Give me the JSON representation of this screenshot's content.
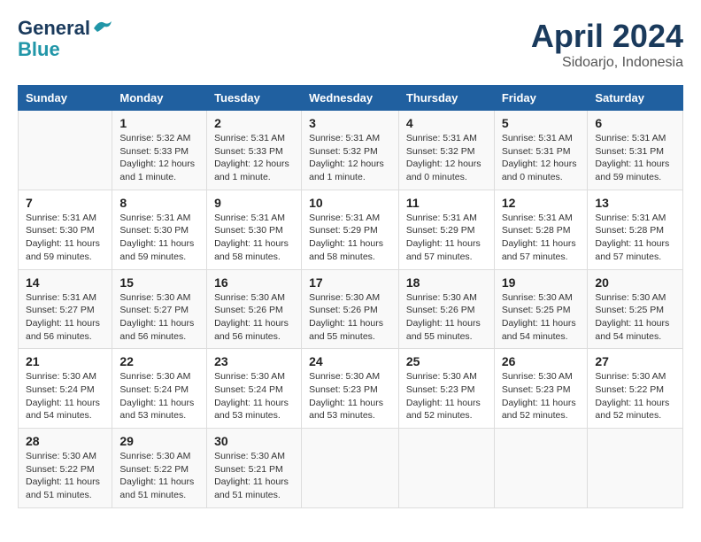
{
  "logo": {
    "line1": "General",
    "line2": "Blue"
  },
  "title": "April 2024",
  "location": "Sidoarjo, Indonesia",
  "days_header": [
    "Sunday",
    "Monday",
    "Tuesday",
    "Wednesday",
    "Thursday",
    "Friday",
    "Saturday"
  ],
  "weeks": [
    [
      {
        "num": "",
        "info": ""
      },
      {
        "num": "1",
        "info": "Sunrise: 5:32 AM\nSunset: 5:33 PM\nDaylight: 12 hours\nand 1 minute."
      },
      {
        "num": "2",
        "info": "Sunrise: 5:31 AM\nSunset: 5:33 PM\nDaylight: 12 hours\nand 1 minute."
      },
      {
        "num": "3",
        "info": "Sunrise: 5:31 AM\nSunset: 5:32 PM\nDaylight: 12 hours\nand 1 minute."
      },
      {
        "num": "4",
        "info": "Sunrise: 5:31 AM\nSunset: 5:32 PM\nDaylight: 12 hours\nand 0 minutes."
      },
      {
        "num": "5",
        "info": "Sunrise: 5:31 AM\nSunset: 5:31 PM\nDaylight: 12 hours\nand 0 minutes."
      },
      {
        "num": "6",
        "info": "Sunrise: 5:31 AM\nSunset: 5:31 PM\nDaylight: 11 hours\nand 59 minutes."
      }
    ],
    [
      {
        "num": "7",
        "info": "Sunrise: 5:31 AM\nSunset: 5:30 PM\nDaylight: 11 hours\nand 59 minutes."
      },
      {
        "num": "8",
        "info": "Sunrise: 5:31 AM\nSunset: 5:30 PM\nDaylight: 11 hours\nand 59 minutes."
      },
      {
        "num": "9",
        "info": "Sunrise: 5:31 AM\nSunset: 5:30 PM\nDaylight: 11 hours\nand 58 minutes."
      },
      {
        "num": "10",
        "info": "Sunrise: 5:31 AM\nSunset: 5:29 PM\nDaylight: 11 hours\nand 58 minutes."
      },
      {
        "num": "11",
        "info": "Sunrise: 5:31 AM\nSunset: 5:29 PM\nDaylight: 11 hours\nand 57 minutes."
      },
      {
        "num": "12",
        "info": "Sunrise: 5:31 AM\nSunset: 5:28 PM\nDaylight: 11 hours\nand 57 minutes."
      },
      {
        "num": "13",
        "info": "Sunrise: 5:31 AM\nSunset: 5:28 PM\nDaylight: 11 hours\nand 57 minutes."
      }
    ],
    [
      {
        "num": "14",
        "info": "Sunrise: 5:31 AM\nSunset: 5:27 PM\nDaylight: 11 hours\nand 56 minutes."
      },
      {
        "num": "15",
        "info": "Sunrise: 5:30 AM\nSunset: 5:27 PM\nDaylight: 11 hours\nand 56 minutes."
      },
      {
        "num": "16",
        "info": "Sunrise: 5:30 AM\nSunset: 5:26 PM\nDaylight: 11 hours\nand 56 minutes."
      },
      {
        "num": "17",
        "info": "Sunrise: 5:30 AM\nSunset: 5:26 PM\nDaylight: 11 hours\nand 55 minutes."
      },
      {
        "num": "18",
        "info": "Sunrise: 5:30 AM\nSunset: 5:26 PM\nDaylight: 11 hours\nand 55 minutes."
      },
      {
        "num": "19",
        "info": "Sunrise: 5:30 AM\nSunset: 5:25 PM\nDaylight: 11 hours\nand 54 minutes."
      },
      {
        "num": "20",
        "info": "Sunrise: 5:30 AM\nSunset: 5:25 PM\nDaylight: 11 hours\nand 54 minutes."
      }
    ],
    [
      {
        "num": "21",
        "info": "Sunrise: 5:30 AM\nSunset: 5:24 PM\nDaylight: 11 hours\nand 54 minutes."
      },
      {
        "num": "22",
        "info": "Sunrise: 5:30 AM\nSunset: 5:24 PM\nDaylight: 11 hours\nand 53 minutes."
      },
      {
        "num": "23",
        "info": "Sunrise: 5:30 AM\nSunset: 5:24 PM\nDaylight: 11 hours\nand 53 minutes."
      },
      {
        "num": "24",
        "info": "Sunrise: 5:30 AM\nSunset: 5:23 PM\nDaylight: 11 hours\nand 53 minutes."
      },
      {
        "num": "25",
        "info": "Sunrise: 5:30 AM\nSunset: 5:23 PM\nDaylight: 11 hours\nand 52 minutes."
      },
      {
        "num": "26",
        "info": "Sunrise: 5:30 AM\nSunset: 5:23 PM\nDaylight: 11 hours\nand 52 minutes."
      },
      {
        "num": "27",
        "info": "Sunrise: 5:30 AM\nSunset: 5:22 PM\nDaylight: 11 hours\nand 52 minutes."
      }
    ],
    [
      {
        "num": "28",
        "info": "Sunrise: 5:30 AM\nSunset: 5:22 PM\nDaylight: 11 hours\nand 51 minutes."
      },
      {
        "num": "29",
        "info": "Sunrise: 5:30 AM\nSunset: 5:22 PM\nDaylight: 11 hours\nand 51 minutes."
      },
      {
        "num": "30",
        "info": "Sunrise: 5:30 AM\nSunset: 5:21 PM\nDaylight: 11 hours\nand 51 minutes."
      },
      {
        "num": "",
        "info": ""
      },
      {
        "num": "",
        "info": ""
      },
      {
        "num": "",
        "info": ""
      },
      {
        "num": "",
        "info": ""
      }
    ]
  ]
}
